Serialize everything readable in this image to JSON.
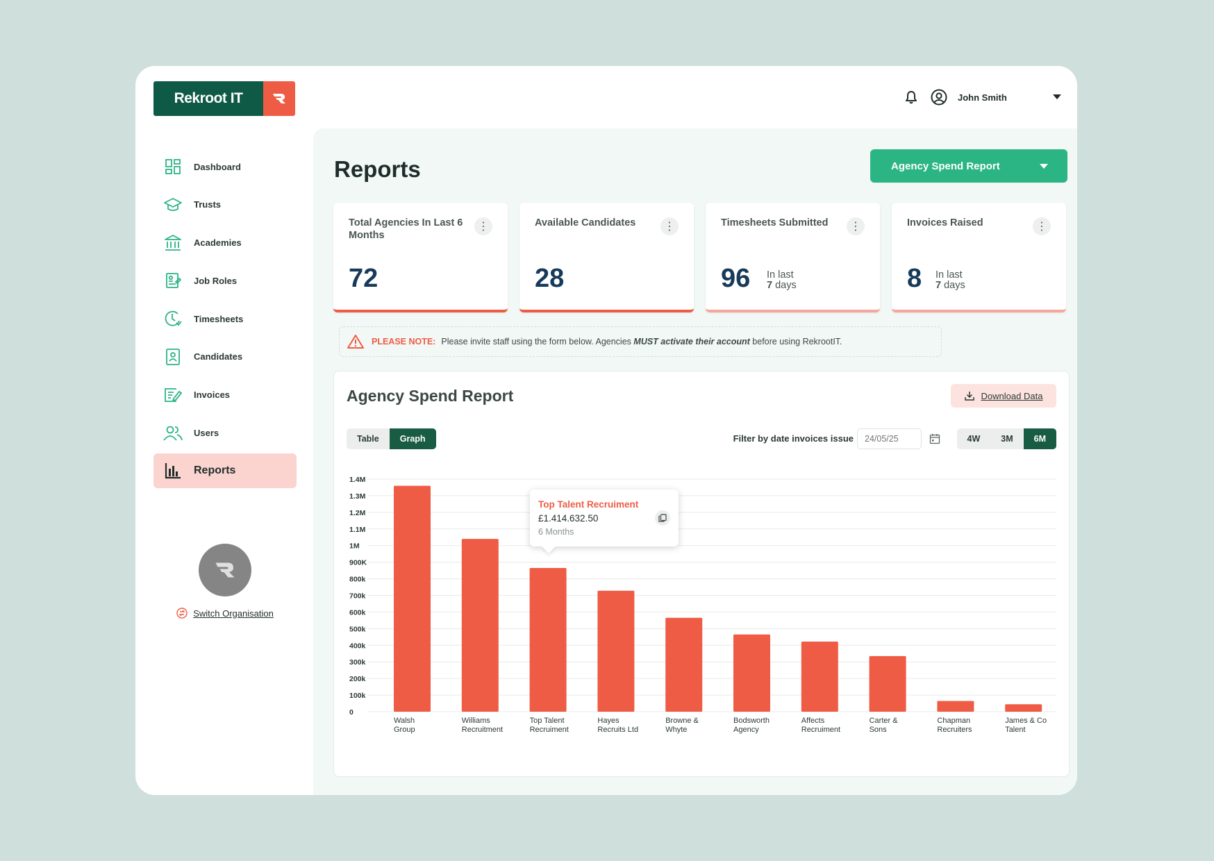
{
  "header": {
    "logo_text": "Rekroot IT",
    "user_name": "John Smith"
  },
  "sidebar": {
    "items": [
      {
        "label": "Dashboard",
        "icon": "dashboard-icon"
      },
      {
        "label": "Trusts",
        "icon": "graduation-cap-icon"
      },
      {
        "label": "Academies",
        "icon": "institution-icon"
      },
      {
        "label": "Job Roles",
        "icon": "job-roles-icon"
      },
      {
        "label": "Timesheets",
        "icon": "clock-icon"
      },
      {
        "label": "Candidates",
        "icon": "candidate-icon"
      },
      {
        "label": "Invoices",
        "icon": "invoice-icon"
      },
      {
        "label": "Users",
        "icon": "users-icon"
      },
      {
        "label": "Reports",
        "icon": "bar-chart-icon",
        "active": true
      }
    ],
    "switch_org": "Switch Organisation"
  },
  "main": {
    "title": "Reports",
    "report_select": "Agency Spend Report",
    "stats": [
      {
        "label": "Total Agencies In Last 6 Months",
        "value": "72"
      },
      {
        "label": "Available Candidates",
        "value": "28"
      },
      {
        "label": "Timesheets Submitted",
        "value": "96",
        "note_prefix": "In last",
        "note_strong": "7",
        "note_suffix": "days"
      },
      {
        "label": "Invoices Raised",
        "value": "8",
        "note_prefix": "In last",
        "note_strong": "7",
        "note_suffix": "days"
      }
    ],
    "note": {
      "label": "PLEASE NOTE:",
      "text_before": "Please invite staff using the form below. Agencies",
      "text_emphasis": "MUST activate their account",
      "text_after": "before using RekrootIT."
    },
    "card": {
      "title": "Agency Spend Report",
      "download": "Download Data",
      "view_options": [
        "Table",
        "Graph"
      ],
      "view_selected": "Graph",
      "filter_label": "Filter by date invoices issue",
      "date_placeholder": "24/05/25",
      "range_options": [
        "4W",
        "3M",
        "6M"
      ],
      "range_selected": "6M"
    },
    "tooltip": {
      "name": "Top Talent Recruiment",
      "value": "£1.414.632.50",
      "period": "6 Months"
    }
  },
  "colors": {
    "brand_green": "#0f5a46",
    "accent_green": "#2bb584",
    "accent_red": "#ef5c45",
    "active_nav_bg": "#fbd3cf"
  },
  "chart_data": {
    "type": "bar",
    "categories": [
      [
        "Walsh",
        "Group"
      ],
      [
        "Williams",
        "Recruitment"
      ],
      [
        "Top Talent",
        "Recruiment"
      ],
      [
        "Hayes",
        "Recruits Ltd"
      ],
      [
        "Browne &",
        "Whyte"
      ],
      [
        "Bodsworth",
        "Agency"
      ],
      [
        "Affects",
        "Recruiment"
      ],
      [
        "Carter &",
        "Sons"
      ],
      [
        "Chapman",
        "Recruiters"
      ],
      [
        "James & Co",
        "Talent"
      ]
    ],
    "values": [
      1360000,
      1040000,
      865000,
      728000,
      565000,
      465000,
      422000,
      335000,
      65000,
      45000
    ],
    "ylim": [
      0,
      1400000
    ],
    "y_ticks": [
      {
        "v": 0,
        "label": "0"
      },
      {
        "v": 100000,
        "label": "100k"
      },
      {
        "v": 200000,
        "label": "200k"
      },
      {
        "v": 300000,
        "label": "300k"
      },
      {
        "v": 400000,
        "label": "400k"
      },
      {
        "v": 500000,
        "label": "500k"
      },
      {
        "v": 600000,
        "label": "600k"
      },
      {
        "v": 700000,
        "label": "700k"
      },
      {
        "v": 800000,
        "label": "800k"
      },
      {
        "v": 900000,
        "label": "900K"
      },
      {
        "v": 1000000,
        "label": "1M"
      },
      {
        "v": 1100000,
        "label": "1.1M"
      },
      {
        "v": 1200000,
        "label": "1.2M"
      },
      {
        "v": 1300000,
        "label": "1.3M"
      },
      {
        "v": 1400000,
        "label": "1.4M"
      }
    ],
    "grid": true,
    "bar_color": "#ef5c45"
  }
}
